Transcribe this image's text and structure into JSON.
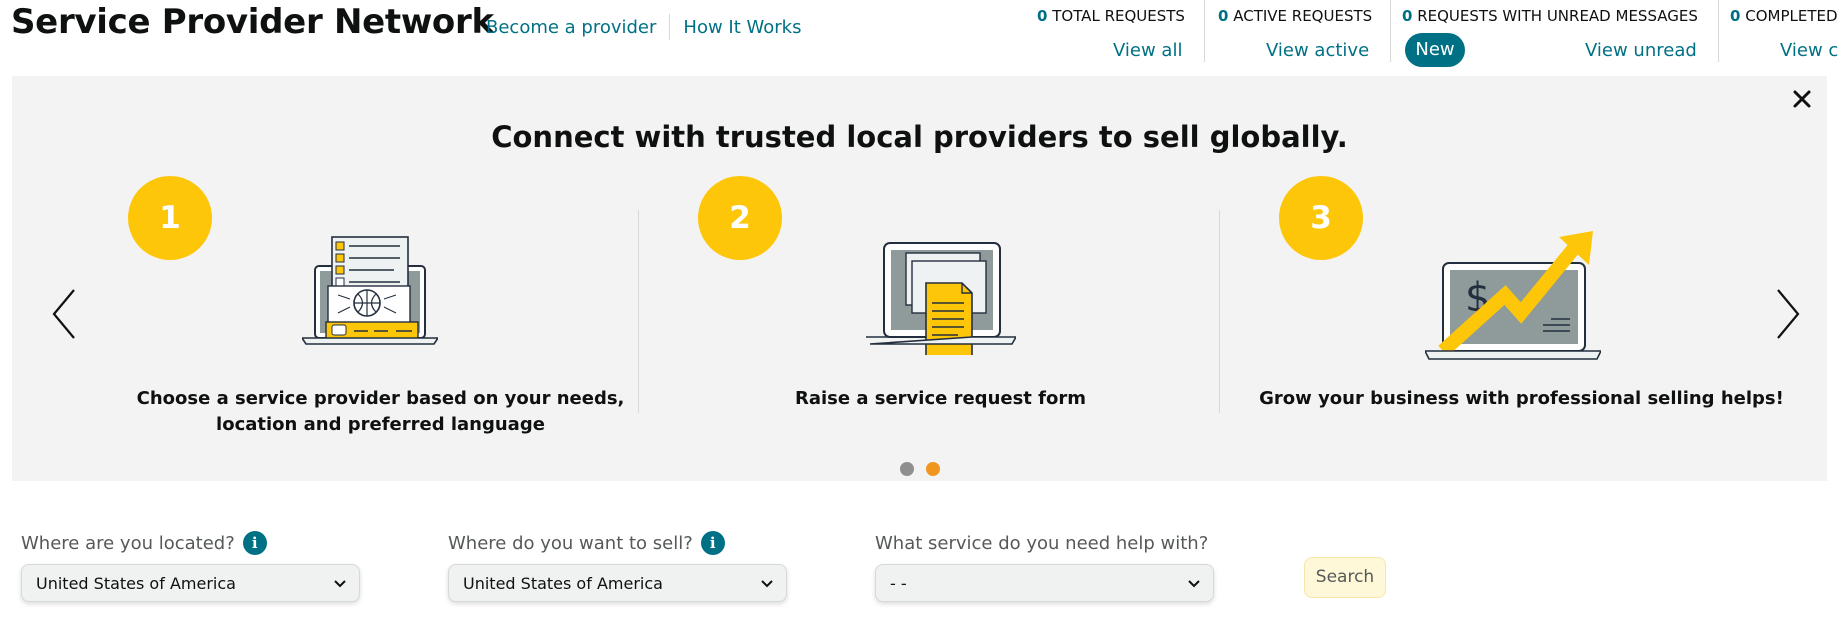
{
  "header": {
    "title": "Service Provider Network",
    "links": [
      "Become a provider",
      "How It Works"
    ]
  },
  "stats": [
    {
      "count": "0",
      "label": "TOTAL REQUESTS",
      "link": "View all"
    },
    {
      "count": "0",
      "label": "ACTIVE REQUESTS",
      "link": "View active"
    },
    {
      "count": "0",
      "label": "REQUESTS WITH UNREAD MESSAGES",
      "link": "View unread",
      "badge": "New"
    },
    {
      "count": "0",
      "label": "COMPLETED REQUESTS",
      "link": "View completed"
    }
  ],
  "banner": {
    "heading": "Connect with trusted local providers to sell globally.",
    "steps": [
      {
        "number": "1",
        "caption": "Choose a service provider based on your needs, location and preferred language",
        "icon": "laptop-checklist-globe-icon"
      },
      {
        "number": "2",
        "caption": "Raise a service request form",
        "icon": "laptop-document-icon"
      },
      {
        "number": "3",
        "caption": "Grow your business with professional selling helps!",
        "icon": "laptop-growth-chart-icon"
      }
    ],
    "active_slide": 2,
    "slide_count": 2
  },
  "form": {
    "located": {
      "label": "Where are you located?",
      "value": "United States of America"
    },
    "sell": {
      "label": "Where do you want to sell?",
      "value": "United States of America"
    },
    "service": {
      "label": "What service do you need help with?",
      "value": "- -"
    },
    "search_label": "Search"
  },
  "colors": {
    "link": "#007185",
    "accent_yellow": "#fec609",
    "dot_active": "#f0961e",
    "dot_inactive": "#8f8f8f",
    "banner_bg": "#f3f3f3"
  }
}
